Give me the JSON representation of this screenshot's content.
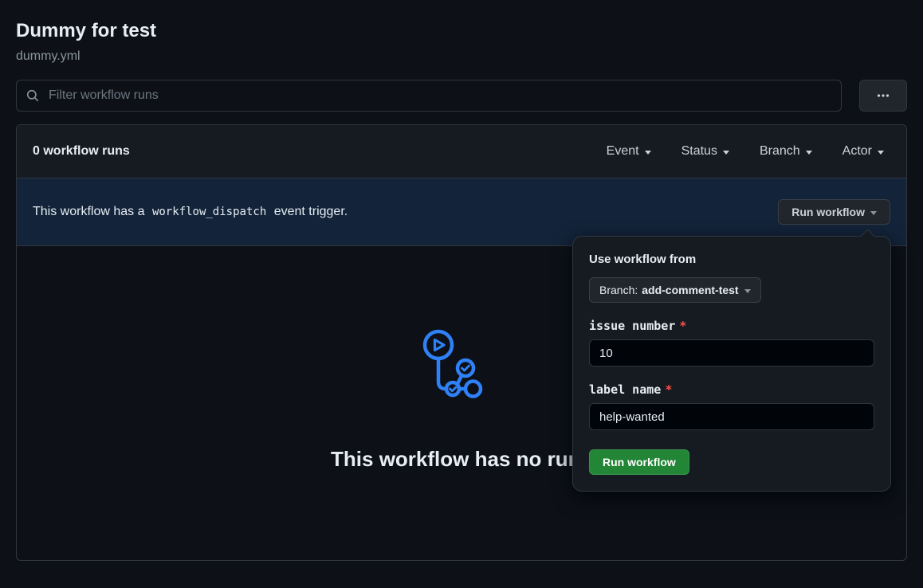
{
  "page": {
    "title": "Dummy for test",
    "subtitle": "dummy.yml"
  },
  "toolbar": {
    "filter_placeholder": "Filter workflow runs"
  },
  "runs_panel": {
    "count_label": "0 workflow runs",
    "filters": [
      {
        "label": "Event"
      },
      {
        "label": "Status"
      },
      {
        "label": "Branch"
      },
      {
        "label": "Actor"
      }
    ],
    "banner": {
      "text_before": "This workflow has a",
      "code": "workflow_dispatch",
      "text_after": "event trigger.",
      "run_button_label": "Run workflow"
    },
    "empty_state": {
      "heading": "This workflow has no runs"
    }
  },
  "dispatch_popover": {
    "title": "Use workflow from",
    "branch_prefix": "Branch:",
    "branch_name": "add-comment-test",
    "fields": [
      {
        "label": "issue number",
        "required_marker": "*",
        "value": "10"
      },
      {
        "label": "label name",
        "required_marker": "*",
        "value": "help-wanted"
      }
    ],
    "submit_label": "Run workflow"
  },
  "icons": {
    "search": "magnifier",
    "kebab": "horizontal-three-dots",
    "chevron_down": "caret-down-triangle",
    "workflow_graph": "actions-workflow-logo"
  },
  "colors": {
    "background": "#0d1117",
    "panel_header": "#161b22",
    "border": "#30363d",
    "accent_blue": "#2f81f7",
    "success_green": "#238636",
    "danger_red": "#f85149"
  }
}
